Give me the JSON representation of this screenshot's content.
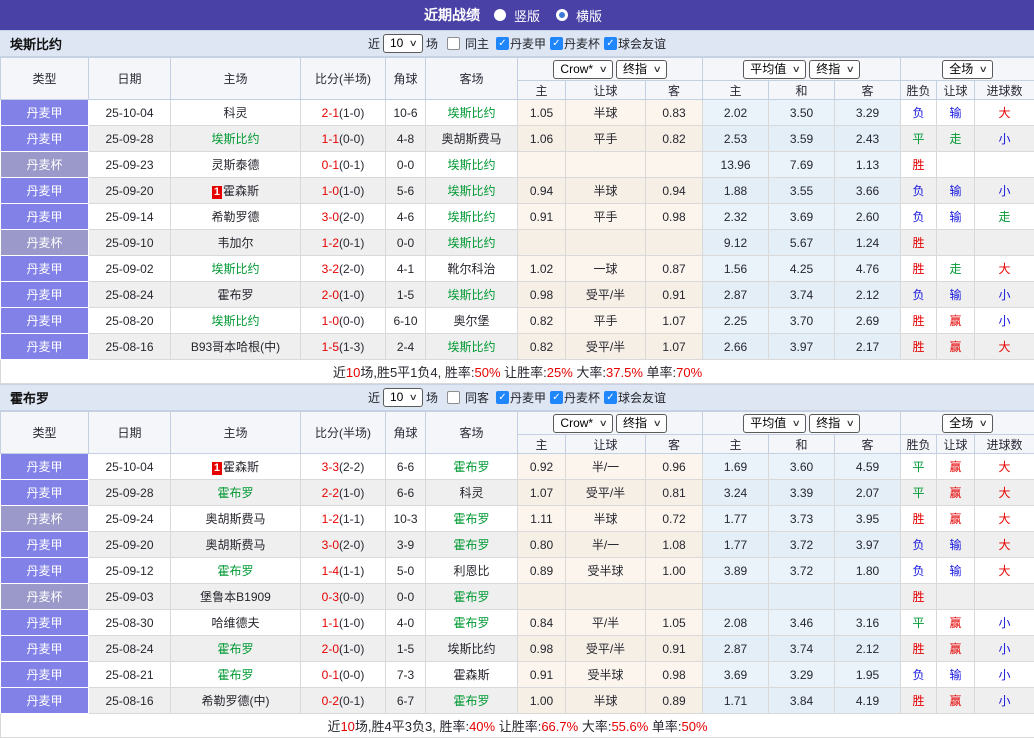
{
  "title_bar": {
    "title": "近期战绩",
    "radio_vertical": "竖版",
    "radio_horizontal": "横版"
  },
  "cols": {
    "type": "类型",
    "date": "日期",
    "home": "主场",
    "score": "比分(半场)",
    "corner": "角球",
    "away": "客场",
    "h_home": "主",
    "h_line": "让球",
    "h_away": "客",
    "a_home": "主",
    "a_draw": "和",
    "a_away": "客",
    "r_wdl": "胜负",
    "r_hcp": "让球",
    "r_goal": "进球数"
  },
  "dropdowns": {
    "bookmaker": "Crow*",
    "final1": "终指",
    "average": "平均值",
    "final2": "终指",
    "fullmatch": "全场"
  },
  "colors": {
    "accent": "#4a41a6",
    "league": "#8181e8",
    "cup": "#9a99c9",
    "win": "#e60000",
    "loss": "#1717dd",
    "draw": "#009933",
    "checkbox": "#2086fb"
  },
  "sections": [
    {
      "team": "埃斯比约",
      "filter": {
        "near": "近",
        "count": "10",
        "games": "场",
        "same_label": "同主",
        "same_checked": false,
        "leagues": [
          "丹麦甲",
          "丹麦杯",
          "球会友谊"
        ]
      },
      "rows": [
        {
          "tc": "lg",
          "type": "丹麦甲",
          "date": "25-10-04",
          "home": "科灵",
          "hb": "",
          "hg": 0,
          "score": "2-1",
          "half": "(1-0)",
          "corner": "10-6",
          "away": "埃斯比约",
          "ag": 1,
          "o1": "1.05",
          "line": "半球",
          "o2": "0.83",
          "a1": "2.02",
          "a2": "3.50",
          "a3": "3.29",
          "w": "负",
          "wc": "b",
          "h2": "输",
          "hc2": "b",
          "ou": "大",
          "oc": "r"
        },
        {
          "tc": "lg",
          "type": "丹麦甲",
          "date": "25-09-28",
          "home": "埃斯比约",
          "hb": "",
          "hg": 1,
          "score": "1-1",
          "half": "(0-0)",
          "corner": "4-8",
          "away": "奥胡斯费马",
          "ag": 0,
          "o1": "1.06",
          "line": "平手",
          "o2": "0.82",
          "a1": "2.53",
          "a2": "3.59",
          "a3": "2.43",
          "w": "平",
          "wc": "g",
          "h2": "走",
          "hc2": "g",
          "ou": "小",
          "oc": "b"
        },
        {
          "tc": "cup",
          "type": "丹麦杯",
          "date": "25-09-23",
          "home": "灵斯泰德",
          "hb": "",
          "hg": 0,
          "score": "0-1",
          "half": "(0-1)",
          "corner": "0-0",
          "away": "埃斯比约",
          "ag": 1,
          "o1": "",
          "line": "",
          "o2": "",
          "a1": "13.96",
          "a2": "7.69",
          "a3": "1.13",
          "w": "胜",
          "wc": "r",
          "h2": "",
          "hc2": "",
          "ou": "",
          "oc": ""
        },
        {
          "tc": "lg",
          "type": "丹麦甲",
          "date": "25-09-20",
          "home": "霍森斯",
          "hb": "1",
          "hg": 0,
          "score": "1-0",
          "half": "(1-0)",
          "corner": "5-6",
          "away": "埃斯比约",
          "ag": 1,
          "o1": "0.94",
          "line": "半球",
          "o2": "0.94",
          "a1": "1.88",
          "a2": "3.55",
          "a3": "3.66",
          "w": "负",
          "wc": "b",
          "h2": "输",
          "hc2": "b",
          "ou": "小",
          "oc": "b"
        },
        {
          "tc": "lg",
          "type": "丹麦甲",
          "date": "25-09-14",
          "home": "希勒罗德",
          "hb": "",
          "hg": 0,
          "score": "3-0",
          "half": "(2-0)",
          "corner": "4-6",
          "away": "埃斯比约",
          "ag": 1,
          "o1": "0.91",
          "line": "平手",
          "o2": "0.98",
          "a1": "2.32",
          "a2": "3.69",
          "a3": "2.60",
          "w": "负",
          "wc": "b",
          "h2": "输",
          "hc2": "b",
          "ou": "走",
          "oc": "g"
        },
        {
          "tc": "cup",
          "type": "丹麦杯",
          "date": "25-09-10",
          "home": "韦加尔",
          "hb": "",
          "hg": 0,
          "score": "1-2",
          "half": "(0-1)",
          "corner": "0-0",
          "away": "埃斯比约",
          "ag": 1,
          "o1": "",
          "line": "",
          "o2": "",
          "a1": "9.12",
          "a2": "5.67",
          "a3": "1.24",
          "w": "胜",
          "wc": "r",
          "h2": "",
          "hc2": "",
          "ou": "",
          "oc": ""
        },
        {
          "tc": "lg",
          "type": "丹麦甲",
          "date": "25-09-02",
          "home": "埃斯比约",
          "hb": "",
          "hg": 1,
          "score": "3-2",
          "half": "(2-0)",
          "corner": "4-1",
          "away": "靴尔科治",
          "ag": 0,
          "o1": "1.02",
          "line": "一球",
          "o2": "0.87",
          "a1": "1.56",
          "a2": "4.25",
          "a3": "4.76",
          "w": "胜",
          "wc": "r",
          "h2": "走",
          "hc2": "g",
          "ou": "大",
          "oc": "r"
        },
        {
          "tc": "lg",
          "type": "丹麦甲",
          "date": "25-08-24",
          "home": "霍布罗",
          "hb": "",
          "hg": 0,
          "score": "2-0",
          "half": "(1-0)",
          "corner": "1-5",
          "away": "埃斯比约",
          "ag": 1,
          "o1": "0.98",
          "line": "受平/半",
          "o2": "0.91",
          "a1": "2.87",
          "a2": "3.74",
          "a3": "2.12",
          "w": "负",
          "wc": "b",
          "h2": "输",
          "hc2": "b",
          "ou": "小",
          "oc": "b"
        },
        {
          "tc": "lg",
          "type": "丹麦甲",
          "date": "25-08-20",
          "home": "埃斯比约",
          "hb": "",
          "hg": 1,
          "score": "1-0",
          "half": "(0-0)",
          "corner": "6-10",
          "away": "奥尔堡",
          "ag": 0,
          "o1": "0.82",
          "line": "平手",
          "o2": "1.07",
          "a1": "2.25",
          "a2": "3.70",
          "a3": "2.69",
          "w": "胜",
          "wc": "r",
          "h2": "赢",
          "hc2": "r",
          "ou": "小",
          "oc": "b"
        },
        {
          "tc": "lg",
          "type": "丹麦甲",
          "date": "25-08-16",
          "home": "B93哥本哈根(中)",
          "hb": "",
          "hg": 0,
          "score": "1-5",
          "half": "(1-3)",
          "corner": "2-4",
          "away": "埃斯比约",
          "ag": 1,
          "o1": "0.82",
          "line": "受平/半",
          "o2": "1.07",
          "a1": "2.66",
          "a2": "3.97",
          "a3": "2.17",
          "w": "胜",
          "wc": "r",
          "h2": "赢",
          "hc2": "r",
          "ou": "大",
          "oc": "r"
        }
      ],
      "summary": [
        [
          "近",
          0
        ],
        [
          "10",
          1
        ],
        [
          "场,胜5平1负4, 胜率:",
          0
        ],
        [
          "50%",
          1
        ],
        [
          " 让胜率:",
          0
        ],
        [
          "25%",
          1
        ],
        [
          " 大率:",
          0
        ],
        [
          "37.5%",
          1
        ],
        [
          " 单率:",
          0
        ],
        [
          "70%",
          1
        ]
      ]
    },
    {
      "team": "霍布罗",
      "filter": {
        "near": "近",
        "count": "10",
        "games": "场",
        "same_label": "同客",
        "same_checked": false,
        "leagues": [
          "丹麦甲",
          "丹麦杯",
          "球会友谊"
        ]
      },
      "rows": [
        {
          "tc": "lg",
          "type": "丹麦甲",
          "date": "25-10-04",
          "home": "霍森斯",
          "hb": "1",
          "hg": 0,
          "score": "3-3",
          "half": "(2-2)",
          "corner": "6-6",
          "away": "霍布罗",
          "ag": 1,
          "o1": "0.92",
          "line": "半/一",
          "o2": "0.96",
          "a1": "1.69",
          "a2": "3.60",
          "a3": "4.59",
          "w": "平",
          "wc": "g",
          "h2": "赢",
          "hc2": "r",
          "ou": "大",
          "oc": "r"
        },
        {
          "tc": "lg",
          "type": "丹麦甲",
          "date": "25-09-28",
          "home": "霍布罗",
          "hb": "",
          "hg": 1,
          "score": "2-2",
          "half": "(1-0)",
          "corner": "6-6",
          "away": "科灵",
          "ag": 0,
          "o1": "1.07",
          "line": "受平/半",
          "o2": "0.81",
          "a1": "3.24",
          "a2": "3.39",
          "a3": "2.07",
          "w": "平",
          "wc": "g",
          "h2": "赢",
          "hc2": "r",
          "ou": "大",
          "oc": "r"
        },
        {
          "tc": "cup",
          "type": "丹麦杯",
          "date": "25-09-24",
          "home": "奥胡斯费马",
          "hb": "",
          "hg": 0,
          "score": "1-2",
          "half": "(1-1)",
          "corner": "10-3",
          "away": "霍布罗",
          "ag": 1,
          "o1": "1.11",
          "line": "半球",
          "o2": "0.72",
          "a1": "1.77",
          "a2": "3.73",
          "a3": "3.95",
          "w": "胜",
          "wc": "r",
          "h2": "赢",
          "hc2": "r",
          "ou": "大",
          "oc": "r"
        },
        {
          "tc": "lg",
          "type": "丹麦甲",
          "date": "25-09-20",
          "home": "奥胡斯费马",
          "hb": "",
          "hg": 0,
          "score": "3-0",
          "half": "(2-0)",
          "corner": "3-9",
          "away": "霍布罗",
          "ag": 1,
          "o1": "0.80",
          "line": "半/一",
          "o2": "1.08",
          "a1": "1.77",
          "a2": "3.72",
          "a3": "3.97",
          "w": "负",
          "wc": "b",
          "h2": "输",
          "hc2": "b",
          "ou": "大",
          "oc": "r"
        },
        {
          "tc": "lg",
          "type": "丹麦甲",
          "date": "25-09-12",
          "home": "霍布罗",
          "hb": "",
          "hg": 1,
          "score": "1-4",
          "half": "(1-1)",
          "corner": "5-0",
          "away": "利恩比",
          "ag": 0,
          "o1": "0.89",
          "line": "受半球",
          "o2": "1.00",
          "a1": "3.89",
          "a2": "3.72",
          "a3": "1.80",
          "w": "负",
          "wc": "b",
          "h2": "输",
          "hc2": "b",
          "ou": "大",
          "oc": "r"
        },
        {
          "tc": "cup",
          "type": "丹麦杯",
          "date": "25-09-03",
          "home": "堡鲁本B1909",
          "hb": "",
          "hg": 0,
          "score": "0-3",
          "half": "(0-0)",
          "corner": "0-0",
          "away": "霍布罗",
          "ag": 1,
          "o1": "",
          "line": "",
          "o2": "",
          "a1": "",
          "a2": "",
          "a3": "",
          "w": "胜",
          "wc": "r",
          "h2": "",
          "hc2": "",
          "ou": "",
          "oc": ""
        },
        {
          "tc": "lg",
          "type": "丹麦甲",
          "date": "25-08-30",
          "home": "哈维德夫",
          "hb": "",
          "hg": 0,
          "score": "1-1",
          "half": "(1-0)",
          "corner": "4-0",
          "away": "霍布罗",
          "ag": 1,
          "o1": "0.84",
          "line": "平/半",
          "o2": "1.05",
          "a1": "2.08",
          "a2": "3.46",
          "a3": "3.16",
          "w": "平",
          "wc": "g",
          "h2": "赢",
          "hc2": "r",
          "ou": "小",
          "oc": "b"
        },
        {
          "tc": "lg",
          "type": "丹麦甲",
          "date": "25-08-24",
          "home": "霍布罗",
          "hb": "",
          "hg": 1,
          "score": "2-0",
          "half": "(1-0)",
          "corner": "1-5",
          "away": "埃斯比约",
          "ag": 0,
          "o1": "0.98",
          "line": "受平/半",
          "o2": "0.91",
          "a1": "2.87",
          "a2": "3.74",
          "a3": "2.12",
          "w": "胜",
          "wc": "r",
          "h2": "赢",
          "hc2": "r",
          "ou": "小",
          "oc": "b"
        },
        {
          "tc": "lg",
          "type": "丹麦甲",
          "date": "25-08-21",
          "home": "霍布罗",
          "hb": "",
          "hg": 1,
          "score": "0-1",
          "half": "(0-0)",
          "corner": "7-3",
          "away": "霍森斯",
          "ag": 0,
          "o1": "0.91",
          "line": "受半球",
          "o2": "0.98",
          "a1": "3.69",
          "a2": "3.29",
          "a3": "1.95",
          "w": "负",
          "wc": "b",
          "h2": "输",
          "hc2": "b",
          "ou": "小",
          "oc": "b"
        },
        {
          "tc": "lg",
          "type": "丹麦甲",
          "date": "25-08-16",
          "home": "希勒罗德(中)",
          "hb": "",
          "hg": 0,
          "score": "0-2",
          "half": "(0-1)",
          "corner": "6-7",
          "away": "霍布罗",
          "ag": 1,
          "o1": "1.00",
          "line": "半球",
          "o2": "0.89",
          "a1": "1.71",
          "a2": "3.84",
          "a3": "4.19",
          "w": "胜",
          "wc": "r",
          "h2": "赢",
          "hc2": "r",
          "ou": "小",
          "oc": "b"
        }
      ],
      "summary": [
        [
          "近",
          0
        ],
        [
          "10",
          1
        ],
        [
          "场,胜4平3负3, 胜率:",
          0
        ],
        [
          "40%",
          1
        ],
        [
          " 让胜率:",
          0
        ],
        [
          "66.7%",
          1
        ],
        [
          " 大率:",
          0
        ],
        [
          "55.6%",
          1
        ],
        [
          " 单率:",
          0
        ],
        [
          "50%",
          1
        ]
      ]
    }
  ]
}
